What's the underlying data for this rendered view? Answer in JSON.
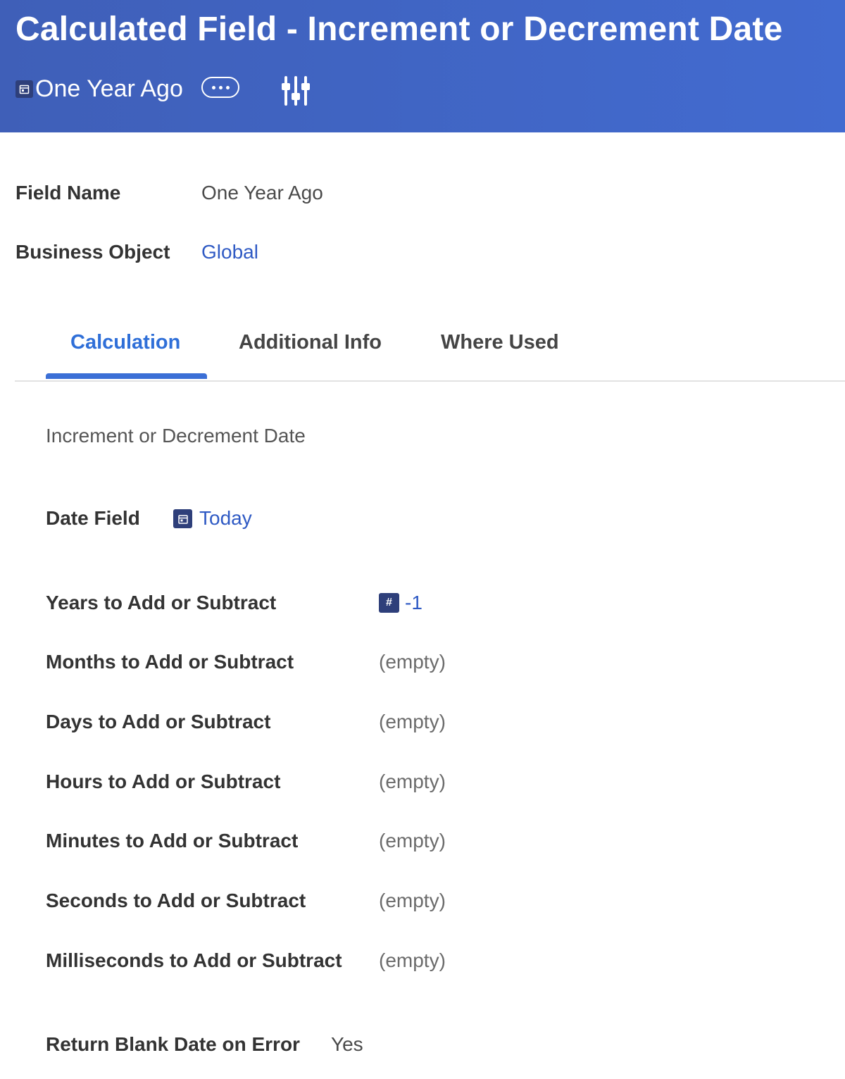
{
  "header": {
    "title": "Calculated Field - Increment or Decrement Date",
    "subject_name": "One Year Ago",
    "subject_icon": "calendar-icon",
    "related_actions_icon": "more-horizontal-icon",
    "configure_icon": "sliders-icon"
  },
  "summary": {
    "field_name_label": "Field Name",
    "field_name_value": "One Year Ago",
    "business_object_label": "Business Object",
    "business_object_value": "Global"
  },
  "tabs": [
    {
      "label": "Calculation",
      "active": true
    },
    {
      "label": "Additional Info",
      "active": false
    },
    {
      "label": "Where Used",
      "active": false
    }
  ],
  "calculation": {
    "type_label": "Increment or Decrement Date",
    "date_field_label": "Date Field",
    "date_field_value": "Today",
    "date_field_icon": "calendar-icon",
    "number_icon_glyph": "#",
    "rows": [
      {
        "label": "Years to Add or Subtract",
        "value": "-1"
      },
      {
        "label": "Months to Add or Subtract",
        "value": "(empty)"
      },
      {
        "label": "Days to Add or Subtract",
        "value": "(empty)"
      },
      {
        "label": "Hours to Add or Subtract",
        "value": "(empty)"
      },
      {
        "label": "Minutes to Add or Subtract",
        "value": "(empty)"
      },
      {
        "label": "Seconds to Add or Subtract",
        "value": "(empty)"
      },
      {
        "label": "Milliseconds to Add or Subtract",
        "value": "(empty)"
      }
    ],
    "return_blank_label": "Return Blank Date on Error",
    "return_blank_value": "Yes"
  },
  "colors": {
    "header_bg": "#426bd0",
    "link": "#2f5ac4",
    "active_tab": "#2f6fd8",
    "badge": "#2e3f7a"
  }
}
